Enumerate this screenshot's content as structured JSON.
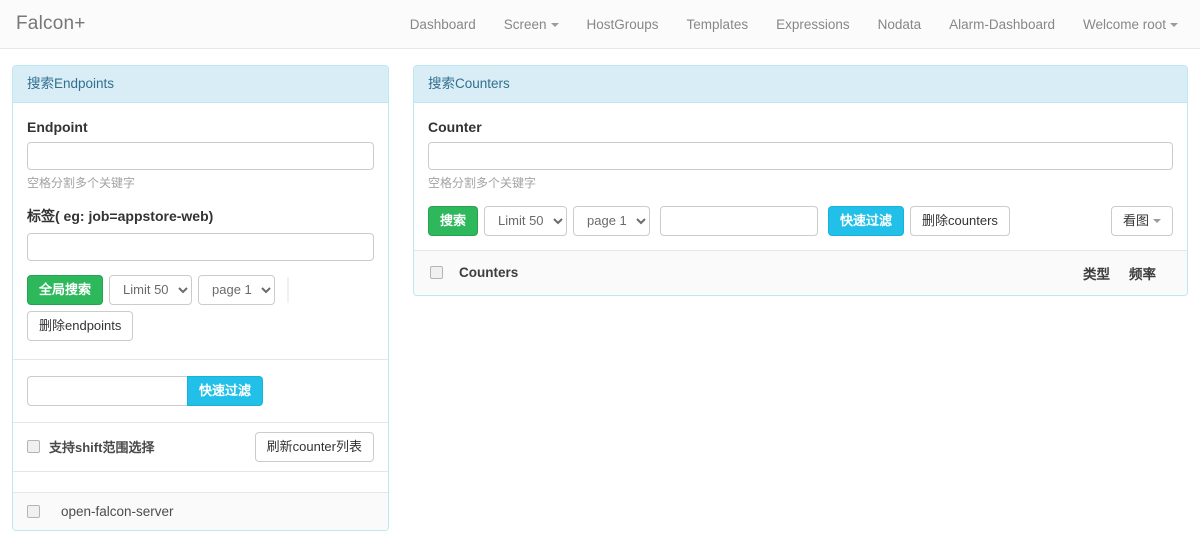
{
  "navbar": {
    "brand": "Falcon+",
    "links": [
      {
        "label": "Dashboard",
        "caret": false
      },
      {
        "label": "Screen",
        "caret": true
      },
      {
        "label": "HostGroups",
        "caret": false
      },
      {
        "label": "Templates",
        "caret": false
      },
      {
        "label": "Expressions",
        "caret": false
      },
      {
        "label": "Nodata",
        "caret": false
      },
      {
        "label": "Alarm-Dashboard",
        "caret": false
      },
      {
        "label": "Welcome root",
        "caret": true
      }
    ]
  },
  "endpoints_panel": {
    "heading": "搜索Endpoints",
    "endpoint_label": "Endpoint",
    "endpoint_value": "",
    "endpoint_help": "空格分割多个关键字",
    "tag_label": "标签( eg: job=appstore-web)",
    "tag_value": "",
    "search_button": "全局搜索",
    "limit_select": "Limit 50",
    "page_select": "page 1",
    "delete_button": "删除endpoints",
    "filter_value": "",
    "filter_button": "快速过滤",
    "shift_label": "支持shift范围选择",
    "refresh_button": "刷新counter列表",
    "list": [
      {
        "name": "open-falcon-server"
      }
    ]
  },
  "counters_panel": {
    "heading": "搜索Counters",
    "counter_label": "Counter",
    "counter_value": "",
    "counter_help": "空格分割多个关键字",
    "search_button": "搜索",
    "limit_select": "Limit 50",
    "page_select": "page 1",
    "filter_value": "",
    "filter_button": "快速过滤",
    "delete_button": "删除counters",
    "chart_button": "看图",
    "table_headers": {
      "counters": "Counters",
      "type": "类型",
      "freq": "频率"
    },
    "rows": []
  },
  "colors": {
    "success": "#2eb85c",
    "info": "#22c0e8",
    "panel_header_bg": "#d9edf7",
    "panel_border": "#bce8f1",
    "panel_header_text": "#31708f"
  }
}
